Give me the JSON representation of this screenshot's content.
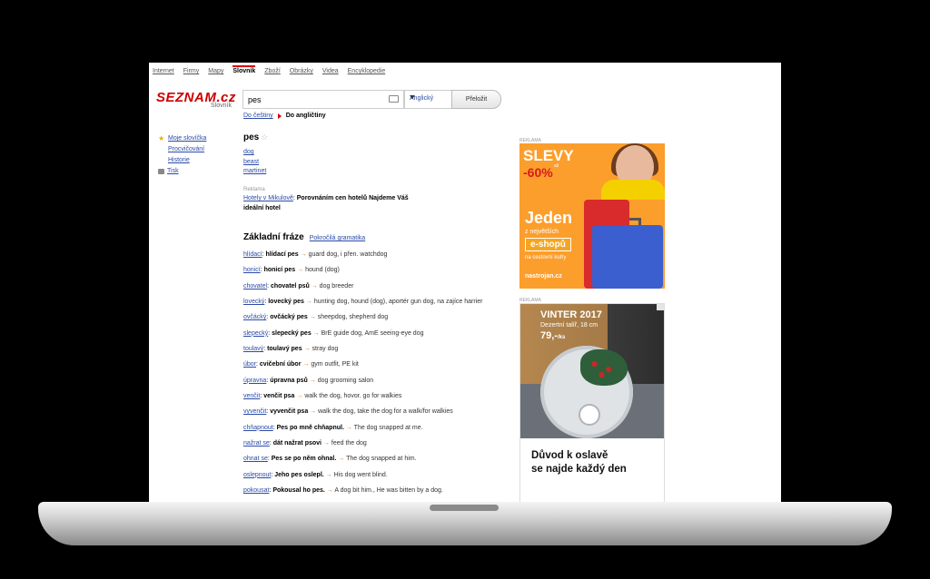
{
  "topnav": [
    "Internet",
    "Firmy",
    "Mapy",
    "Slovník",
    "Zboží",
    "Obrázky",
    "Videa",
    "Encyklopedie"
  ],
  "logo": {
    "text": "SEZNAM.cz",
    "sub": "Slovník"
  },
  "search": {
    "value": "pes",
    "language": "Anglický",
    "submit": "Přeložit"
  },
  "direction": {
    "to_czech": "Do češtiny",
    "to_english": "Do angličtiny"
  },
  "sidebar": {
    "my_words": "Moje slovíčka",
    "practice": "Procvičování",
    "history": "Historie",
    "print": "Tisk"
  },
  "entry": {
    "headword": "pes",
    "translations": [
      "dog",
      "beast",
      "martinet"
    ]
  },
  "ad_inline": {
    "label": "Reklama",
    "link": "Hotely v Mikulově",
    "text": "Porovnáním cen hotelů Najdeme Váš ideální hotel"
  },
  "phrases": {
    "title": "Základní fráze",
    "grammar_link": "Pokročilá gramatika",
    "items": [
      {
        "word": "hlídací",
        "phrase": "hlídací pes",
        "en": "guard dog, i přen. watchdog"
      },
      {
        "word": "honicí",
        "phrase": "honicí pes",
        "en": "hound (dog)"
      },
      {
        "word": "chovatel",
        "phrase": "chovatel psů",
        "en": "dog breeder"
      },
      {
        "word": "lovecký",
        "phrase": "lovecký pes",
        "en": "hunting dog, hound (dog), aportér gun dog, na zajíce harrier"
      },
      {
        "word": "ovčácký",
        "phrase": "ovčácký pes",
        "en": "sheepdog, shepherd dog"
      },
      {
        "word": "slepecký",
        "phrase": "slepecký pes",
        "en": "BrE guide dog, AmE seeing-eye dog"
      },
      {
        "word": "toulavý",
        "phrase": "toulavý pes",
        "en": "stray dog"
      },
      {
        "word": "úbor",
        "phrase": "cvičební úbor",
        "en": "gym outfit, PE kit"
      },
      {
        "word": "úpravna",
        "phrase": "úpravna psů",
        "en": "dog grooming salon"
      },
      {
        "word": "venčit",
        "phrase": "venčit psa",
        "en": "walk the dog, hovor. go for walkies"
      },
      {
        "word": "vyvenčit",
        "phrase": "vyvenčit psa",
        "en": "walk the dog, take the dog for a walk/for walkies"
      },
      {
        "word": "chňapnout",
        "phrase": "Pes po mně chňapnul.",
        "en": "The dog snapped at me."
      },
      {
        "word": "nažrat se",
        "phrase": "dát nažrat psovi",
        "en": "feed the dog"
      },
      {
        "word": "ohnat se",
        "phrase": "Pes se po něm ohnal.",
        "en": "The dog snapped at him."
      },
      {
        "word": "oslepnout",
        "phrase": "Jeho pes oslepl.",
        "en": "His dog went blind."
      },
      {
        "word": "pokousat",
        "phrase": "Pokousal ho pes.",
        "en": "A dog bit him., He was bitten by a dog."
      }
    ]
  },
  "ads": {
    "label": "REKLAMA",
    "ad1": {
      "headline": "SLEVY",
      "discount": "-60%",
      "upto": "až",
      "title": "Jeden",
      "sub": "z největších",
      "cta": "e-shopů",
      "subline": "na cestovní kufry",
      "brand": "nastrojan.cz"
    },
    "ad2": {
      "title": "VINTER 2017",
      "product": "Dezertní talíř, 18 cm",
      "price": "79,-",
      "unit": "/ks",
      "tagline_1": "Důvod k oslavě",
      "tagline_2": "se najde každý den"
    }
  }
}
